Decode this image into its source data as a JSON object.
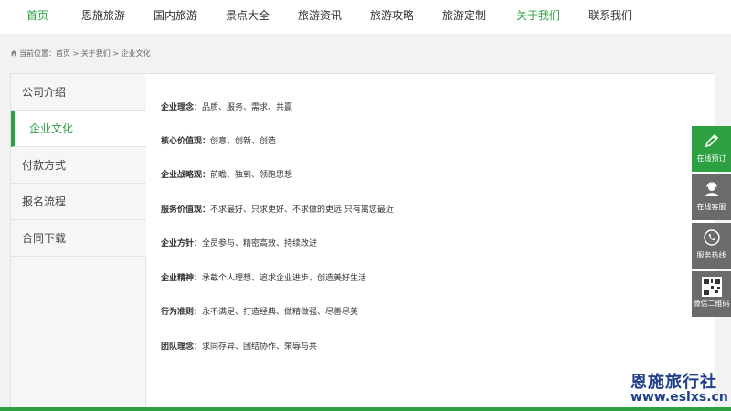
{
  "nav": {
    "items": [
      "首页",
      "恩施旅游",
      "国内旅游",
      "景点大全",
      "旅游资讯",
      "旅游攻略",
      "旅游定制",
      "关于我们",
      "联系我们"
    ],
    "active_indices": [
      0,
      7
    ]
  },
  "breadcrumb": {
    "text": "当前位置：首页 > 关于我们 > 企业文化"
  },
  "sidebar": {
    "items": [
      "公司介绍",
      "企业文化",
      "付款方式",
      "报名流程",
      "合同下载"
    ],
    "active_index": 1
  },
  "content": {
    "rows": [
      {
        "key": "企业理念：",
        "value": "品质、服务、需求、共赢"
      },
      {
        "key": "核心价值观：",
        "value": "创意、创新、创造"
      },
      {
        "key": "企业战略观：",
        "value": "前瞻、独到、领跑思想"
      },
      {
        "key": "服务价值观：",
        "value": "不求最好、只求更好、不求做的更远 只有离您最近"
      },
      {
        "key": "企业方针：",
        "value": "全员参与、精密高效、持续改进"
      },
      {
        "key": "企业精神：",
        "value": "承载个人理想、追求企业进步、创造美好生活"
      },
      {
        "key": "行为准则：",
        "value": "永不满足、打造经典、做精做强、尽善尽美"
      },
      {
        "key": "团队理念：",
        "value": "求同存异、团结协作、荣辱与共"
      }
    ]
  },
  "float_bar": {
    "items": [
      {
        "label": "在线预订",
        "icon": "pencil-icon"
      },
      {
        "label": "在线客服",
        "icon": "customer-service-icon"
      },
      {
        "label": "服务热线",
        "icon": "phone-icon"
      },
      {
        "label": "微信二维码",
        "icon": "qr-code-icon"
      }
    ]
  },
  "logo": {
    "name": "恩施旅行社",
    "url": "www.eslxs.cn"
  },
  "colors": {
    "accent": "#2da042",
    "float_bg": "#6b6b6b",
    "logo": "#1f3f8a"
  }
}
